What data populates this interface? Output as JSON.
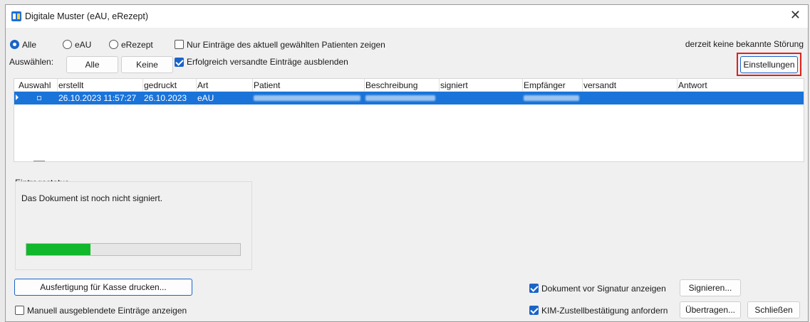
{
  "window": {
    "title": "Digitale Muster (eAU, eRezept)"
  },
  "filter": {
    "radio_all": "Alle",
    "radio_eau": "eAU",
    "radio_erezept": "eRezept",
    "only_patient_label": "Nur Einträge des aktuell gewählten Patienten zeigen",
    "status_text": "derzeit keine bekannte Störung"
  },
  "select": {
    "label": "Auswählen:",
    "all_button": "Alle",
    "none_button": "Keine",
    "hide_sent_label": "Erfolgreich versandte Einträge ausblenden"
  },
  "settings_button": "Einstellungen",
  "table": {
    "columns": [
      "Auswahl",
      "erstellt",
      "gedruckt",
      "Art",
      "Patient",
      "Beschreibung",
      "signiert",
      "Empfänger",
      "versandt",
      "Antwort"
    ],
    "rows": [
      {
        "erstellt": "26.10.2023 11:57:27",
        "gedruckt": "26.10.2023",
        "art": "eAU"
      }
    ]
  },
  "status": {
    "group_label": "Eintragsstatus",
    "message": "Das Dokument ist noch nicht signiert.",
    "progress_fraction": 0.3
  },
  "footer": {
    "print_button": "Ausfertigung für Kasse drucken...",
    "show_hidden_label": "Manuell ausgeblendete Einträge anzeigen",
    "show_before_sign_label": "Dokument vor Signatur anzeigen",
    "kim_label": "KIM-Zustellbestätigung anfordern",
    "sign_button": "Signieren...",
    "transfer_button": "Übertragen...",
    "close_button": "Schließen"
  }
}
